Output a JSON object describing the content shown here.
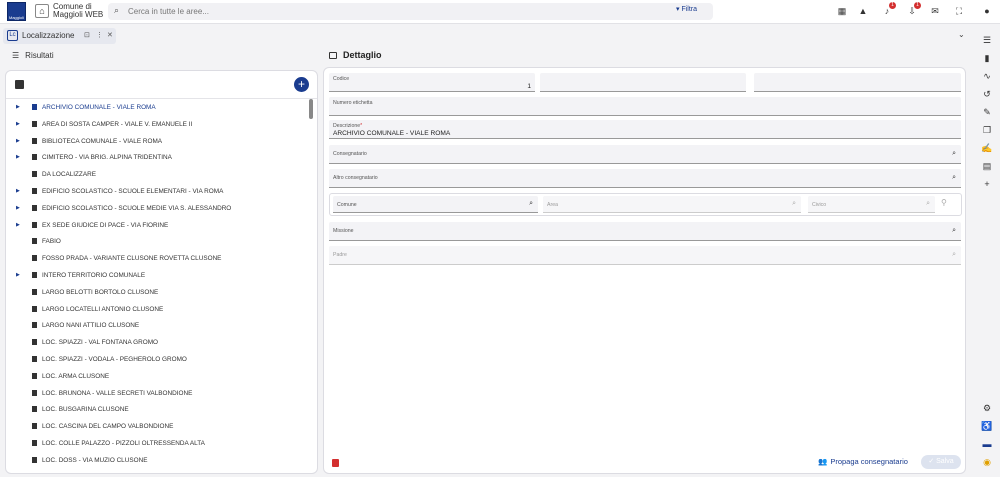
{
  "app": {
    "logo_text": "Maggioli",
    "title_line1": "Comune di",
    "title_line2": "Maggioli WEB",
    "search_placeholder": "Cerca in tutte le aree...",
    "filter_label": "Filtra",
    "icons": [
      "apps-icon",
      "warning-icon",
      "bell-icon",
      "download-icon",
      "mail-icon",
      "fullscreen-icon",
      "account-icon"
    ],
    "badges": {
      "bell": "1",
      "download": "1"
    }
  },
  "tab": {
    "label": "Localizzazione",
    "icon": "localizzazione-icon"
  },
  "left": {
    "header": "Risultati",
    "items": [
      {
        "label": "ARCHIVIO COMUNALE - VIALE ROMA",
        "expandable": true,
        "selected": true
      },
      {
        "label": "AREA DI SOSTA CAMPER - VIALE V. EMANUELE II",
        "expandable": true
      },
      {
        "label": "BIBLIOTECA COMUNALE - VIALE ROMA",
        "expandable": true
      },
      {
        "label": "CIMITERO - VIA BRIG. ALPINA TRIDENTINA",
        "expandable": true
      },
      {
        "label": "DA LOCALIZZARE",
        "expandable": false
      },
      {
        "label": "EDIFICIO SCOLASTICO -  SCUOLE ELEMENTARI -  VIA ROMA",
        "expandable": true
      },
      {
        "label": "EDIFICIO SCOLASTICO - SCUOLE MEDIE VIA S. ALESSANDRO",
        "expandable": true
      },
      {
        "label": "EX SEDE GIUDICE DI PACE - VIA FIORINE",
        "expandable": true
      },
      {
        "label": "FABIO",
        "expandable": false
      },
      {
        "label": "FOSSO PRADA - VARIANTE CLUSONE ROVETTA  CLUSONE",
        "expandable": false
      },
      {
        "label": "INTERO TERRITORIO COMUNALE",
        "expandable": true
      },
      {
        "label": "LARGO BELOTTI BORTOLO CLUSONE",
        "expandable": false
      },
      {
        "label": "LARGO LOCATELLI ANTONIO CLUSONE",
        "expandable": false
      },
      {
        "label": "LARGO NANI ATTILIO CLUSONE",
        "expandable": false
      },
      {
        "label": "LOC.  SPIAZZI - VAL FONTANA  GROMO",
        "expandable": false
      },
      {
        "label": "LOC.  SPIAZZI - VODALA - PEGHEROLO  GROMO",
        "expandable": false
      },
      {
        "label": "LOC. ARMA  CLUSONE",
        "expandable": false
      },
      {
        "label": "LOC. BRUNONA - VALLE SECRETI  VALBONDIONE",
        "expandable": false
      },
      {
        "label": "LOC. BUSGARINA  CLUSONE",
        "expandable": false
      },
      {
        "label": "LOC. CASCINA DEL CAMPO  VALBONDIONE",
        "expandable": false
      },
      {
        "label": "LOC. COLLE PALAZZO - PIZZOLI  OLTRESSENDA ALTA",
        "expandable": false
      },
      {
        "label": "LOC. DOSS - VIA MUZIO  CLUSONE",
        "expandable": false
      }
    ]
  },
  "detail": {
    "title": "Dettaglio",
    "codice_label": "Codice",
    "codice_value": "1",
    "numero_etichetta_label": "Numero etichetta",
    "descrizione_label": "Descrizione",
    "descrizione_value": "ARCHIVIO COMUNALE - VIALE ROMA",
    "consegnatario_label": "Consegnatario",
    "altro_consegnatario_label": "Altro consegnatario",
    "comune_label": "Comune",
    "area_label": "Area",
    "civico_label": "Civico",
    "missione_label": "Missione",
    "padre_label": "Padre",
    "propaga_label": "Propaga consegnatario",
    "salva_label": "Salva"
  }
}
